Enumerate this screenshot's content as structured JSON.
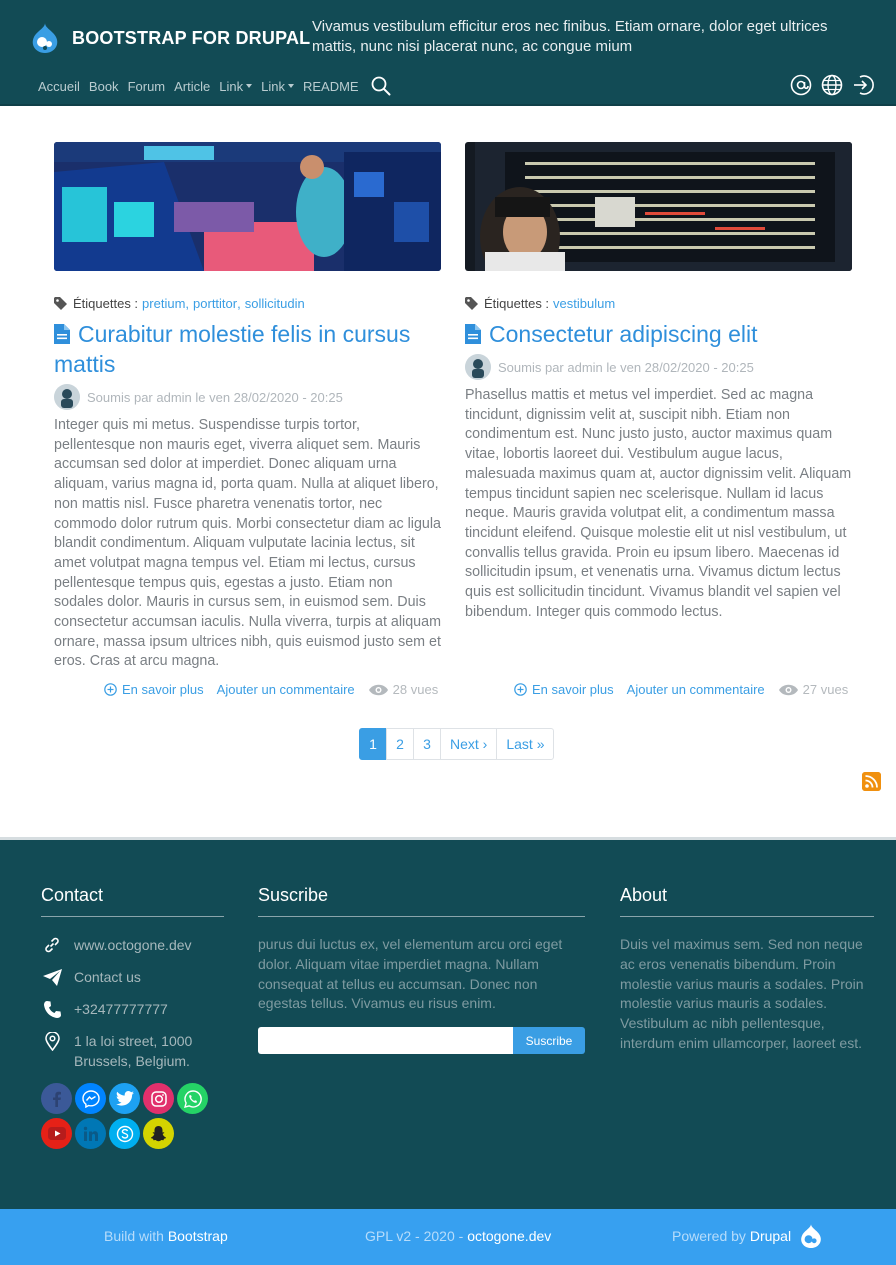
{
  "header": {
    "brand": "BOOTSTRAP FOR DRUPAL",
    "slogan": "Vivamus vestibulum efficitur eros nec finibus. Etiam ornare, dolor eget ultrices mattis, nunc nisi placerat nunc, ac congue mium",
    "nav": [
      "Accueil",
      "Book",
      "Forum",
      "Article",
      "Link",
      "Link",
      "README"
    ],
    "icons": [
      "at-sign-icon",
      "globe-icon",
      "login-icon"
    ]
  },
  "articles": [
    {
      "tags_label": "Étiquettes :",
      "tags": [
        "pretium",
        "porttitor",
        "sollicitudin"
      ],
      "title": "Curabitur molestie felis in cursus mattis",
      "submitted": "Soumis par admin le ven 28/02/2020 - 20:25",
      "body": "Integer quis mi metus. Suspendisse turpis tortor, pellentesque non mauris eget, viverra aliquet sem. Mauris accumsan sed dolor at imperdiet. Donec aliquam urna aliquam, varius magna id, porta quam. Nulla at aliquet libero, non mattis nisl. Fusce pharetra venenatis tortor, nec commodo dolor rutrum quis. Morbi consectetur diam ac ligula blandit condimentum. Aliquam vulputate lacinia lectus, sit amet volutpat magna tempus vel. Etiam mi lectus, cursus pellentesque tempus quis, egestas a justo. Etiam non sodales dolor. Mauris in cursus sem, in euismod sem. Duis consectetur accumsan iaculis. Nulla viverra, turpis at aliquam ornare, massa ipsum ultrices nibh, quis euismod justo sem et eros. Cras at arcu magna.",
      "read_more": "En savoir plus",
      "comment": "Ajouter un commentaire",
      "views": "28 vues"
    },
    {
      "tags_label": "Étiquettes :",
      "tags": [
        "vestibulum"
      ],
      "title": "Consectetur adipiscing elit",
      "submitted": "Soumis par admin le ven 28/02/2020 - 20:25",
      "body": "Phasellus mattis et metus vel imperdiet. Sed ac magna tincidunt, dignissim velit at, suscipit nibh. Etiam non condimentum est. Nunc justo justo, auctor maximus quam vitae, lobortis laoreet dui. Vestibulum augue lacus, malesuada maximus quam at, auctor dignissim velit. Aliquam tempus tincidunt sapien nec scelerisque. Nullam id lacus neque. Mauris gravida volutpat elit, a condimentum massa tincidunt eleifend. Quisque molestie elit ut nisl vestibulum, ut convallis tellus gravida. Proin eu ipsum libero. Maecenas id sollicitudin ipsum, et venenatis urna. Vivamus dictum lectus quis est sollicitudin tincidunt. Vivamus blandit vel sapien vel bibendum. Integer quis commodo lectus.",
      "read_more": "En savoir plus",
      "comment": "Ajouter un commentaire",
      "views": "27 vues"
    }
  ],
  "pager": [
    "1",
    "2",
    "3",
    "Next ›",
    "Last »"
  ],
  "footer": {
    "contact": {
      "title": "Contact",
      "website": "www.octogone.dev",
      "contact_us": "Contact us",
      "phone": "+32477777777",
      "address": "1 la loi street, 1000 Brussels, Belgium."
    },
    "socials": [
      "facebook-icon",
      "messenger-icon",
      "twitter-icon",
      "instagram-icon",
      "whatsapp-icon",
      "youtube-icon",
      "linkedin-icon",
      "skype-icon",
      "snapchat-icon"
    ],
    "subscribe": {
      "title": "Suscribe",
      "text": "purus dui luctus ex, vel elementum arcu orci eget dolor. Aliquam vitae imperdiet magna. Nullam consequat at tellus eu accumsan. Donec non egestas tellus. Vivamus eu risus enim.",
      "input_value": "",
      "button": "Suscribe"
    },
    "about": {
      "title": "About",
      "text": "Duis vel maximus sem. Sed non neque ac eros venenatis bibendum. Proin molestie varius mauris a sodales. Proin molestie varius mauris a sodales. Vestibulum ac nibh pellentesque, interdum enim ullamcorper, laoreet est."
    }
  },
  "bottom": {
    "build_prefix": "Build with",
    "build_link": "Bootstrap",
    "license_prefix": "GPL v2 - 2020 -",
    "license_link": "octogone.dev",
    "powered_prefix": "Powered by",
    "powered_link": "Drupal"
  },
  "colors": {
    "header_bg": "#124b55",
    "accent": "#3a9ee4",
    "bottom_bar": "#37a0f0",
    "rss": "#f0900f"
  }
}
